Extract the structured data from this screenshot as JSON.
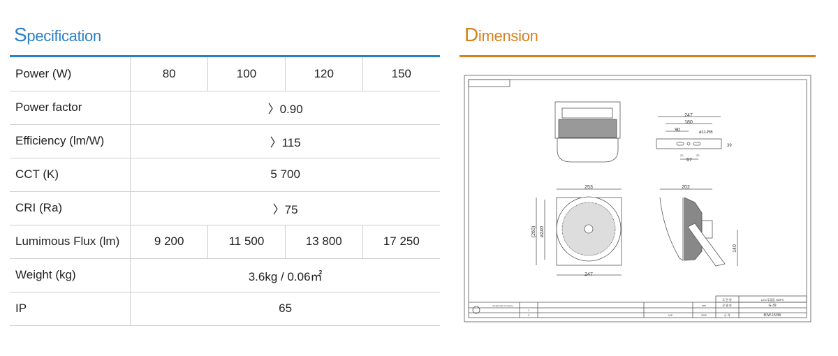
{
  "specification": {
    "title_initial": "S",
    "title_rest": "pecification",
    "rows": [
      {
        "label": "Power (W)",
        "values": [
          "80",
          "100",
          "120",
          "150"
        ]
      },
      {
        "label": "Power factor",
        "value": "〉0.90"
      },
      {
        "label": "Efficiency (lm/W)",
        "value": "〉115"
      },
      {
        "label": "CCT (K)",
        "value": "5 700"
      },
      {
        "label": "CRI (Ra)",
        "value": "〉75"
      },
      {
        "label": "Lumimous Flux (lm)",
        "values": [
          "9 200",
          "11 500",
          "13 800",
          "17 250"
        ]
      },
      {
        "label": "Weight (kg)",
        "value": "3.6kg / 0.06㎡"
      },
      {
        "label": "IP",
        "value": "65"
      }
    ],
    "accent_color": "#2a7fc9"
  },
  "dimension": {
    "title_initial": "D",
    "title_rest": "imension",
    "accent_color": "#d6801c",
    "drawing": {
      "bracket_dims": {
        "total": "247",
        "span": "180",
        "half": "90",
        "hole": "ø11-R6",
        "height": "39",
        "slot_a": "20",
        "slot_b": "20",
        "center": "67"
      },
      "front_dims": {
        "width_top": "253",
        "width_bottom": "247",
        "overall_height": "(260)",
        "diameter": "ø240"
      },
      "side_dims": {
        "depth": "202",
        "arm": "140"
      },
      "title_block": {
        "product_name": "LED 투광등 SMPS",
        "model_no": "G-39",
        "spec": "80W-150W",
        "company": "Global Light Company",
        "unit": "mm",
        "scale": "N/S",
        "year": "2020",
        "label_drawing_name": "도 면 명",
        "label_model": "모 델 명",
        "label_spec": "규 격",
        "rev_1": "1",
        "rev_2": "2"
      }
    }
  }
}
